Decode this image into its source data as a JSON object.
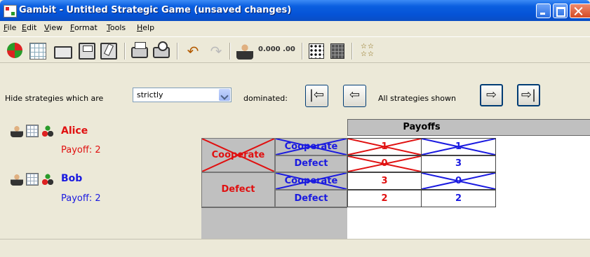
{
  "window": {
    "title": "Gambit - Untitled Strategic Game (unsaved changes)",
    "colors": {
      "titlebar": "#0553d6",
      "close": "#d64b25",
      "face": "#ece9d8"
    }
  },
  "menus": [
    {
      "underline": "F",
      "rest": "ile"
    },
    {
      "underline": "E",
      "rest": "dit"
    },
    {
      "underline": "V",
      "rest": "iew"
    },
    {
      "underline": "F",
      "rest": "ormat"
    },
    {
      "underline": "T",
      "rest": "ools"
    },
    {
      "underline": "H",
      "rest": "elp"
    }
  ],
  "toolbar": {
    "icons": [
      "game-tree-icon",
      "table-icon",
      "open-folder-icon",
      "save-icon",
      "save-as-icon",
      "print-icon",
      "print-preview-icon",
      "undo-icon",
      "redo-icon",
      "add-player-icon",
      "increase-decimals-icon",
      "decrease-decimals-icon",
      "dice-icon",
      "calculator-icon",
      "strategy-profiles-icon"
    ],
    "decimals_up": "0.000",
    "decimals_down": ".00",
    "undo_glyph": "↶",
    "redo_glyph": "↷",
    "profiles_glyph": "☆☆ ☆☆"
  },
  "dominance": {
    "hide_label": "Hide strategies which are",
    "select_value": "strictly",
    "dominated_label": "dominated:",
    "shown_label": "All strategies shown",
    "first_glyph": "|⇦",
    "prev_glyph": "⇦",
    "next_glyph": "⇨",
    "last_glyph": "⇨|"
  },
  "players": [
    {
      "name": "Alice",
      "payoff": "Payoff: 2",
      "color": "#e01010"
    },
    {
      "name": "Bob",
      "payoff": "Payoff: 2",
      "color": "#1a1ae0"
    }
  ],
  "table": {
    "payoffs_header": "Payoffs",
    "row_strategies": [
      "Cooperate",
      "Defect"
    ],
    "col_strategies": [
      "Cooperate",
      "Defect"
    ],
    "payoffs": [
      [
        {
          "alice": "1",
          "bob": "1"
        },
        {
          "alice": "0",
          "bob": "3"
        }
      ],
      [
        {
          "alice": "3",
          "bob": "0"
        },
        {
          "alice": "2",
          "bob": "2"
        }
      ]
    ],
    "dominated": {
      "rows": [
        "Cooperate"
      ],
      "cols": [
        "Cooperate"
      ]
    }
  }
}
